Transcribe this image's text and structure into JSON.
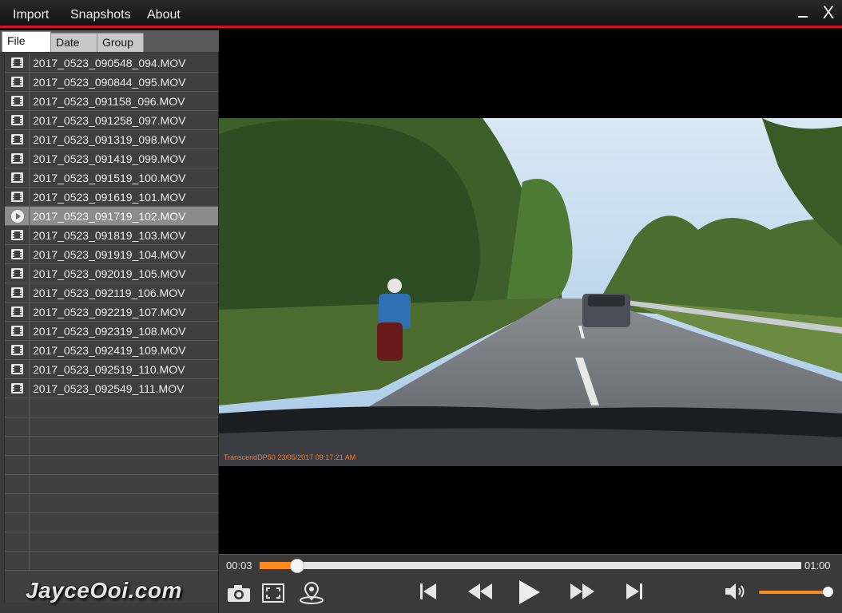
{
  "menubar": {
    "items": [
      {
        "label": "Import"
      },
      {
        "label": "Snapshots"
      },
      {
        "label": "About"
      }
    ],
    "close_glyph": "X"
  },
  "tabs": [
    {
      "label": "File",
      "active": true
    },
    {
      "label": "Date",
      "active": false
    },
    {
      "label": "Group",
      "active": false
    }
  ],
  "files": [
    {
      "name": "2017_0523_090548_094.MOV",
      "icon": "film-icon",
      "playing": false
    },
    {
      "name": "2017_0523_090844_095.MOV",
      "icon": "film-icon",
      "playing": false
    },
    {
      "name": "2017_0523_091158_096.MOV",
      "icon": "film-icon",
      "playing": false
    },
    {
      "name": "2017_0523_091258_097.MOV",
      "icon": "film-icon",
      "playing": false
    },
    {
      "name": "2017_0523_091319_098.MOV",
      "icon": "film-icon",
      "playing": false
    },
    {
      "name": "2017_0523_091419_099.MOV",
      "icon": "film-icon",
      "playing": false
    },
    {
      "name": "2017_0523_091519_100.MOV",
      "icon": "film-icon",
      "playing": false
    },
    {
      "name": "2017_0523_091619_101.MOV",
      "icon": "film-icon",
      "playing": false
    },
    {
      "name": "2017_0523_091719_102.MOV",
      "icon": "play-circle-icon",
      "playing": true
    },
    {
      "name": "2017_0523_091819_103.MOV",
      "icon": "film-icon",
      "playing": false
    },
    {
      "name": "2017_0523_091919_104.MOV",
      "icon": "film-icon",
      "playing": false
    },
    {
      "name": "2017_0523_092019_105.MOV",
      "icon": "film-icon",
      "playing": false
    },
    {
      "name": "2017_0523_092119_106.MOV",
      "icon": "film-icon",
      "playing": false
    },
    {
      "name": "2017_0523_092219_107.MOV",
      "icon": "film-icon",
      "playing": false
    },
    {
      "name": "2017_0523_092319_108.MOV",
      "icon": "film-icon",
      "playing": false
    },
    {
      "name": "2017_0523_092419_109.MOV",
      "icon": "film-icon",
      "playing": false
    },
    {
      "name": "2017_0523_092519_110.MOV",
      "icon": "film-icon",
      "playing": false
    },
    {
      "name": "2017_0523_092549_111.MOV",
      "icon": "film-icon",
      "playing": false
    }
  ],
  "video": {
    "overlay_stamp": "TranscendDP50 23/05/2017 09:17:21 AM"
  },
  "player": {
    "current_time": "00:03",
    "total_time": "01:00",
    "progress": 0.07,
    "volume": 1.0
  },
  "colors": {
    "accent_red": "#d8121a",
    "accent_orange": "#ff8a1e"
  },
  "watermark": "JayceOoi.com"
}
